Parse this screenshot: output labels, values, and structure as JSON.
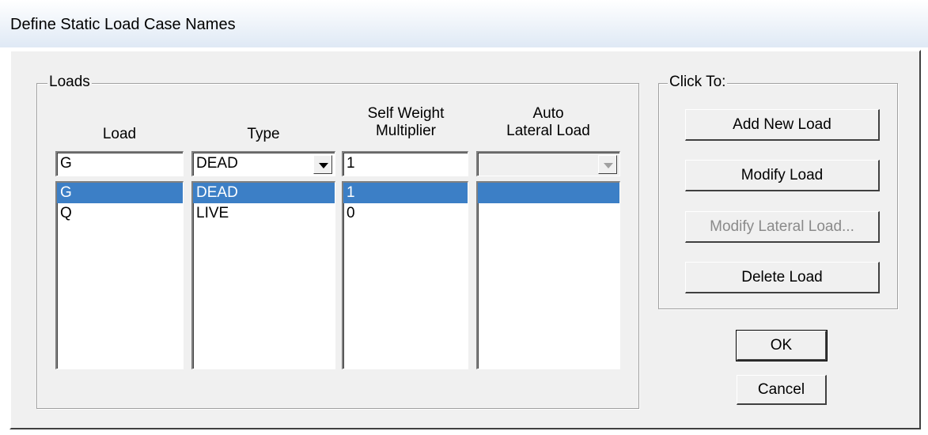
{
  "window": {
    "title": "Define Static Load Case Names"
  },
  "loads_group": {
    "label": "Loads",
    "columns": {
      "load": "Load",
      "type": "Type",
      "self_weight": [
        "Self Weight",
        "Multiplier"
      ],
      "auto_lateral": [
        "Auto",
        "Lateral Load"
      ]
    },
    "inputs": {
      "load": "G",
      "type": "DEAD",
      "self_weight": "1",
      "auto_lateral": ""
    },
    "rows": [
      {
        "load": "G",
        "type": "DEAD",
        "self_weight": "1",
        "auto_lateral": "",
        "selected": true
      },
      {
        "load": "Q",
        "type": "LIVE",
        "self_weight": "0",
        "auto_lateral": "",
        "selected": false
      }
    ]
  },
  "click_to_group": {
    "label": "Click To:",
    "buttons": {
      "add": "Add New Load",
      "modify": "Modify Load",
      "modify_lateral": "Modify Lateral Load...",
      "delete": "Delete Load"
    }
  },
  "ok_label": "OK",
  "cancel_label": "Cancel",
  "colors": {
    "selection": "#3c7fc6",
    "face": "#f0f0f0"
  }
}
